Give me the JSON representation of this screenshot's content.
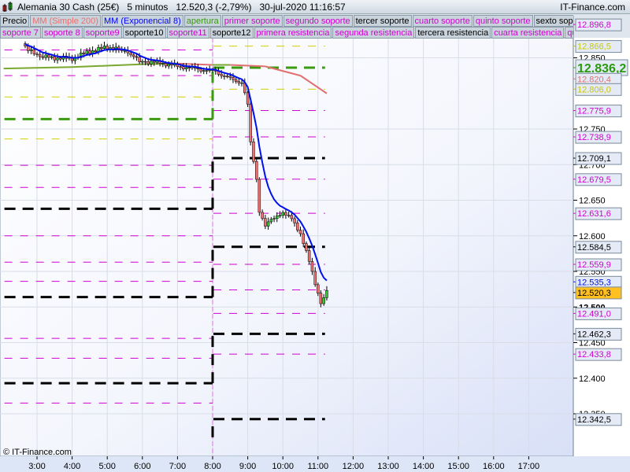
{
  "header": {
    "title": "Alemania 30 Cash (25€)   5 minutos   12.520,3 (-2,79%)   30-jul-2020 11:16:57",
    "site": "IT-Finance.com",
    "watermark": "© IT-Finance.com"
  },
  "legend": {
    "row1": [
      {
        "label": "Precio",
        "color": "#000000"
      },
      {
        "label": "MM (Simple 200)",
        "color": "#e87070"
      },
      {
        "label": "MM (Exponencial 8)",
        "color": "#0000ff"
      },
      {
        "label": "apertura",
        "color": "#3a9a10"
      },
      {
        "label": "primer soporte",
        "color": "#d000d0"
      },
      {
        "label": "segundo soporte",
        "color": "#d000d0"
      },
      {
        "label": "tercer soporte",
        "color": "#000000"
      },
      {
        "label": "cuarto soporte",
        "color": "#d000d0"
      },
      {
        "label": "quinto soporte",
        "color": "#d000d0"
      },
      {
        "label": "sexto soporte",
        "color": "#000000"
      }
    ],
    "row2": [
      {
        "label": "soporte 7",
        "color": "#d000d0"
      },
      {
        "label": "soporte 8",
        "color": "#d000d0"
      },
      {
        "label": "soporte9",
        "color": "#d000d0"
      },
      {
        "label": "soporte10",
        "color": "#000000"
      },
      {
        "label": "soporte11",
        "color": "#d000d0"
      },
      {
        "label": "soporte12",
        "color": "#000000"
      },
      {
        "label": "primera resistencia",
        "color": "#d000d0"
      },
      {
        "label": "segunda resistencia",
        "color": "#d000d0"
      },
      {
        "label": "tercera resistencia",
        "color": "#000000"
      },
      {
        "label": "cuarta resistencia",
        "color": "#d000d0"
      },
      {
        "label": "quinta resistencia",
        "color": "#d000d0"
      }
    ]
  },
  "chart_data": {
    "type": "candlestick",
    "title": "Alemania 30 Cash (25€) 5 minutos",
    "x_ticks": [
      "3:00",
      "4:00",
      "5:00",
      "6:00",
      "7:00",
      "8:00",
      "9:00",
      "10:00",
      "11:00",
      "12:00",
      "13:00",
      "14:00",
      "15:00",
      "16:00",
      "17:00"
    ],
    "x_tick_hours": [
      3,
      4,
      5,
      6,
      7,
      8,
      9,
      10,
      11,
      12,
      13,
      14,
      15,
      16,
      17
    ],
    "xlim_hours": [
      2.05,
      18.1
    ],
    "ylim": [
      12317,
      12935
    ],
    "y_ticks": [
      "12.850",
      "12.750",
      "12.700",
      "12.650",
      "12.600",
      "12.550",
      "12.500",
      "12.450",
      "12.400",
      "12.350"
    ],
    "y_tick_values": [
      12850,
      12750,
      12700,
      12650,
      12600,
      12550,
      12500,
      12450,
      12400,
      12350
    ],
    "close_series": [
      [
        2.58,
        12870
      ],
      [
        3.0,
        12852
      ],
      [
        3.5,
        12850
      ],
      [
        4.0,
        12849
      ],
      [
        4.5,
        12859
      ],
      [
        5.0,
        12865
      ],
      [
        5.33,
        12862
      ],
      [
        5.67,
        12854
      ],
      [
        6.0,
        12845
      ],
      [
        6.5,
        12843
      ],
      [
        7.0,
        12838
      ],
      [
        7.5,
        12835
      ],
      [
        7.83,
        12832
      ],
      [
        8.0,
        12834
      ],
      [
        8.25,
        12826
      ],
      [
        8.5,
        12821
      ],
      [
        8.83,
        12815
      ],
      [
        9.0,
        12787
      ],
      [
        9.08,
        12732
      ],
      [
        9.25,
        12677
      ],
      [
        9.33,
        12633
      ],
      [
        9.5,
        12616
      ],
      [
        9.75,
        12627
      ],
      [
        10.0,
        12630
      ],
      [
        10.25,
        12627
      ],
      [
        10.5,
        12600
      ],
      [
        10.75,
        12567
      ],
      [
        10.92,
        12533
      ],
      [
        11.08,
        12506
      ],
      [
        11.25,
        12520.3
      ]
    ],
    "sma200": [
      [
        2.05,
        12835
      ],
      [
        4.0,
        12837
      ],
      [
        6.0,
        12841
      ],
      [
        7.0,
        12842
      ],
      [
        8.0,
        12840
      ],
      [
        8.5,
        12840
      ],
      [
        9.5,
        12838
      ],
      [
        10.5,
        12825
      ],
      [
        11.25,
        12800
      ]
    ],
    "sma200_colors": {
      "up": "#7aa830",
      "down": "#e07070"
    },
    "ema8_color": "#0010ee",
    "levels": [
      {
        "from": 2.05,
        "to": 8.0,
        "price": 12861,
        "color": "#d000d0",
        "kind": "thin"
      },
      {
        "from": 2.05,
        "to": 8.0,
        "price": 12825,
        "color": "#d000d0",
        "kind": "thin"
      },
      {
        "from": 2.05,
        "to": 8.0,
        "price": 12795,
        "color": "#d0d000",
        "kind": "thin"
      },
      {
        "from": 2.05,
        "to": 8.0,
        "price": 12764,
        "color": "#3a9a10",
        "kind": "open"
      },
      {
        "from": 2.05,
        "to": 8.0,
        "price": 12736,
        "color": "#d0d000",
        "kind": "thin"
      },
      {
        "from": 2.05,
        "to": 8.0,
        "price": 12699,
        "color": "#d000d0",
        "kind": "thin"
      },
      {
        "from": 2.05,
        "to": 8.0,
        "price": 12668,
        "color": "#d000d0",
        "kind": "thin"
      },
      {
        "from": 2.05,
        "to": 8.0,
        "price": 12638,
        "color": "#000000",
        "kind": "thick"
      },
      {
        "from": 2.05,
        "to": 8.0,
        "price": 12600,
        "color": "#d000d0",
        "kind": "thin"
      },
      {
        "from": 2.05,
        "to": 8.0,
        "price": 12563,
        "color": "#d000d0",
        "kind": "thin"
      },
      {
        "from": 2.05,
        "to": 8.0,
        "price": 12536,
        "color": "#d000d0",
        "kind": "thin"
      },
      {
        "from": 2.05,
        "to": 8.0,
        "price": 12514,
        "color": "#000000",
        "kind": "thick"
      },
      {
        "from": 2.05,
        "to": 8.0,
        "price": 12456,
        "color": "#d000d0",
        "kind": "thin"
      },
      {
        "from": 2.05,
        "to": 8.0,
        "price": 12428,
        "color": "#d000d0",
        "kind": "thin"
      },
      {
        "from": 2.05,
        "to": 8.0,
        "price": 12393,
        "color": "#000000",
        "kind": "thick"
      },
      {
        "from": 2.05,
        "to": 8.0,
        "price": 12365,
        "color": "#d000d0",
        "kind": "thin"
      },
      {
        "from": 8.0,
        "to": 11.2,
        "price": 12866.5,
        "color": "#d0d000",
        "kind": "thin"
      },
      {
        "from": 8.0,
        "to": 11.2,
        "price": 12836.2,
        "color": "#3a9a10",
        "kind": "open"
      },
      {
        "from": 8.0,
        "to": 11.2,
        "price": 12806.0,
        "color": "#d0d000",
        "kind": "thin"
      },
      {
        "from": 8.0,
        "to": 11.2,
        "price": 12775.9,
        "color": "#d000d0",
        "kind": "thin"
      },
      {
        "from": 8.0,
        "to": 11.2,
        "price": 12738.9,
        "color": "#d000d0",
        "kind": "thin"
      },
      {
        "from": 8.0,
        "to": 11.2,
        "price": 12709.1,
        "color": "#000000",
        "kind": "thick"
      },
      {
        "from": 8.0,
        "to": 11.2,
        "price": 12679.5,
        "color": "#d000d0",
        "kind": "thin"
      },
      {
        "from": 8.0,
        "to": 11.2,
        "price": 12631.6,
        "color": "#d000d0",
        "kind": "thin"
      },
      {
        "from": 8.0,
        "to": 11.2,
        "price": 12584.5,
        "color": "#000000",
        "kind": "thick"
      },
      {
        "from": 8.0,
        "to": 11.2,
        "price": 12559.9,
        "color": "#d000d0",
        "kind": "thin"
      },
      {
        "from": 8.0,
        "to": 11.2,
        "price": 12524.0,
        "color": "#d000d0",
        "kind": "thin"
      },
      {
        "from": 8.0,
        "to": 11.2,
        "price": 12491.0,
        "color": "#d000d0",
        "kind": "thin"
      },
      {
        "from": 8.0,
        "to": 11.2,
        "price": 12462.3,
        "color": "#000000",
        "kind": "thick"
      },
      {
        "from": 8.0,
        "to": 11.2,
        "price": 12433.8,
        "color": "#d000d0",
        "kind": "thin"
      },
      {
        "from": 8.0,
        "to": 11.2,
        "price": 12342.5,
        "color": "#000000",
        "kind": "thick"
      }
    ],
    "price_tags": [
      {
        "label": "12.896,8",
        "value": 12896.8,
        "color": "#d000d0"
      },
      {
        "label": "12.866,5",
        "value": 12866.5,
        "color": "#c8c800"
      },
      {
        "label": "12.836,2",
        "value": 12836.2,
        "color": "#2a9a10",
        "big": true
      },
      {
        "label": "12.820,4",
        "value": 12820.4,
        "color": "#e07070"
      },
      {
        "label": "12.806,0",
        "value": 12806.0,
        "color": "#c8c800"
      },
      {
        "label": "12.775,9",
        "value": 12775.9,
        "color": "#d000d0"
      },
      {
        "label": "12.738,9",
        "value": 12738.9,
        "color": "#d000d0"
      },
      {
        "label": "12.709,1",
        "value": 12709.1,
        "color": "#000000"
      },
      {
        "label": "12.679,5",
        "value": 12679.5,
        "color": "#d000d0"
      },
      {
        "label": "12.631,6",
        "value": 12631.6,
        "color": "#d000d0"
      },
      {
        "label": "12.584,5",
        "value": 12584.5,
        "color": "#000000"
      },
      {
        "label": "12.559,9",
        "value": 12559.9,
        "color": "#d000d0"
      },
      {
        "label": "12.535,3",
        "value": 12535.3,
        "color": "#0010ee"
      },
      {
        "label": "12.520,3",
        "value": 12520.3,
        "color": "#000000",
        "current": true
      },
      {
        "label": "12.491,0",
        "value": 12491.0,
        "color": "#d000d0"
      },
      {
        "label": "12.462,3",
        "value": 12462.3,
        "color": "#000000"
      },
      {
        "label": "12.433,8",
        "value": 12433.8,
        "color": "#d000d0"
      },
      {
        "label": "12.342,5",
        "value": 12342.5,
        "color": "#000000"
      }
    ]
  }
}
